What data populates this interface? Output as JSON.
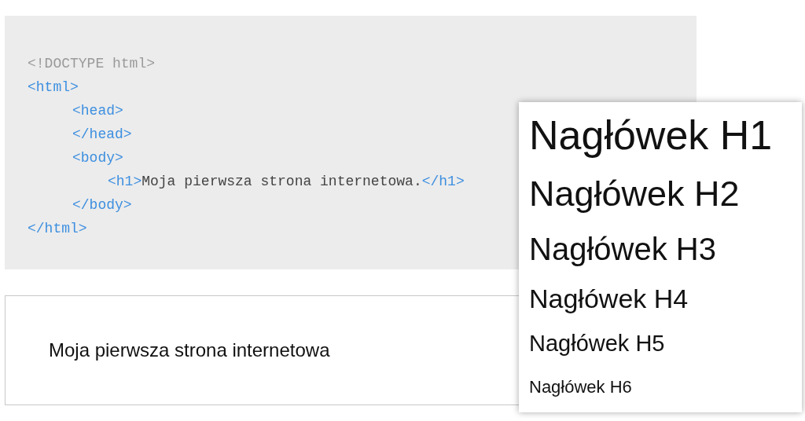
{
  "code_lines": [
    {
      "tokens": [
        {
          "kind": "doctype",
          "text": "<!DOCTYPE html>"
        }
      ]
    },
    {
      "tokens": [
        {
          "kind": "tag",
          "text": "<html>"
        }
      ],
      "children": [
        {
          "tokens": [
            {
              "kind": "tag",
              "text": "<head>"
            }
          ]
        },
        {
          "tokens": [
            {
              "kind": "tag",
              "text": "</head>"
            }
          ]
        },
        {
          "tokens": [
            {
              "kind": "tag",
              "text": "<body>"
            }
          ],
          "children": [
            {
              "tokens": [
                {
                  "kind": "tag",
                  "text": "<h1>"
                },
                {
                  "kind": "text",
                  "text": "Moja pierwsza strona internetowa."
                },
                {
                  "kind": "tag",
                  "text": "</h1>"
                }
              ]
            }
          ]
        },
        {
          "tokens": [
            {
              "kind": "tag",
              "text": "</body>"
            }
          ]
        }
      ]
    },
    {
      "tokens": [
        {
          "kind": "tag",
          "text": "</html>"
        }
      ]
    }
  ],
  "output": {
    "text": "Moja pierwsza strona internetowa"
  },
  "headings": [
    {
      "kind": "h1",
      "text": "Nagłówek H1"
    },
    {
      "kind": "h2",
      "text": "Nagłówek H2"
    },
    {
      "kind": "h3",
      "text": "Nagłówek H3"
    },
    {
      "kind": "h4",
      "text": "Nagłówek H4"
    },
    {
      "kind": "h5",
      "text": "Nagłówek H5"
    },
    {
      "kind": "h6",
      "text": "Nagłówek H6"
    }
  ]
}
